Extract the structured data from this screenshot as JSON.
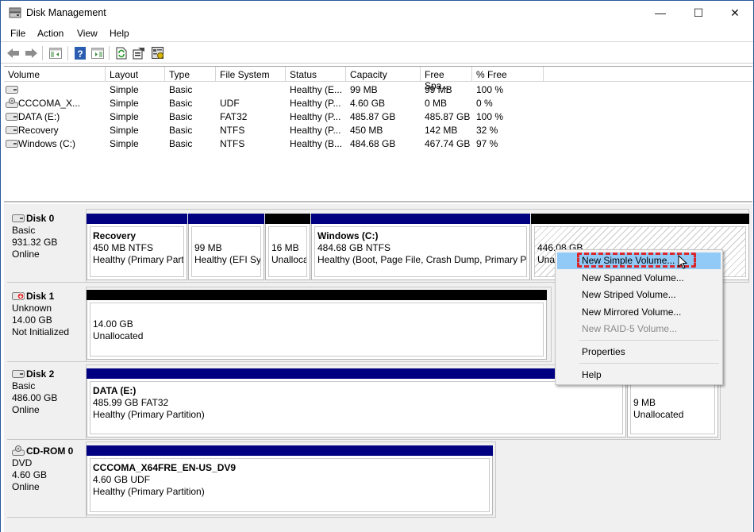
{
  "window": {
    "title": "Disk Management",
    "controls": {
      "minimize": "—",
      "maximize": "☐",
      "close": "✕"
    }
  },
  "menubar": [
    "File",
    "Action",
    "View",
    "Help"
  ],
  "toolbar": {
    "icons": [
      "back-arrow-icon",
      "forward-arrow-icon",
      "show-hide-console-tree-icon",
      "help-icon",
      "show-action-pane-icon",
      "refresh-icon",
      "properties-icon",
      "disk-settings-icon"
    ]
  },
  "volume_list": {
    "columns": [
      "Volume",
      "Layout",
      "Type",
      "File System",
      "Status",
      "Capacity",
      "Free Spa...",
      "% Free"
    ],
    "rows": [
      {
        "icon": "drive-icon",
        "volume": "",
        "layout": "Simple",
        "type": "Basic",
        "fs": "",
        "status": "Healthy (E...",
        "capacity": "99 MB",
        "free": "99 MB",
        "pct": "100 %"
      },
      {
        "icon": "cd-drive-icon",
        "volume": "CCCOMA_X...",
        "layout": "Simple",
        "type": "Basic",
        "fs": "UDF",
        "status": "Healthy (P...",
        "capacity": "4.60 GB",
        "free": "0 MB",
        "pct": "0 %"
      },
      {
        "icon": "drive-icon",
        "volume": "DATA (E:)",
        "layout": "Simple",
        "type": "Basic",
        "fs": "FAT32",
        "status": "Healthy (P...",
        "capacity": "485.87 GB",
        "free": "485.87 GB",
        "pct": "100 %"
      },
      {
        "icon": "drive-icon",
        "volume": "Recovery",
        "layout": "Simple",
        "type": "Basic",
        "fs": "NTFS",
        "status": "Healthy (P...",
        "capacity": "450 MB",
        "free": "142 MB",
        "pct": "32 %"
      },
      {
        "icon": "drive-icon",
        "volume": "Windows (C:)",
        "layout": "Simple",
        "type": "Basic",
        "fs": "NTFS",
        "status": "Healthy (B...",
        "capacity": "484.68 GB",
        "free": "467.74 GB",
        "pct": "97 %"
      }
    ]
  },
  "disks": [
    {
      "name": "Disk 0",
      "kind": "Basic",
      "size": "931.32 GB",
      "state": "Online",
      "partitions": [
        {
          "title": "Recovery",
          "line1": "450 MB NTFS",
          "line2": "Healthy (Primary Part"
        },
        {
          "title": "",
          "line1": "99 MB",
          "line2": "Healthy (EFI Sys"
        },
        {
          "title": "",
          "line1": "16 MB",
          "line2": "Unalloca"
        },
        {
          "title": "Windows  (C:)",
          "line1": "484.68 GB NTFS",
          "line2": "Healthy (Boot, Page File, Crash Dump, Primary Par"
        },
        {
          "title": "",
          "line1": "446.08 GB",
          "line2": "Una"
        }
      ]
    },
    {
      "name": "Disk 1",
      "kind": "Unknown",
      "size": "14.00 GB",
      "state": "Not Initialized",
      "partitions": [
        {
          "title": "",
          "line1": "14.00 GB",
          "line2": "Unallocated"
        }
      ]
    },
    {
      "name": "Disk 2",
      "kind": "Basic",
      "size": "486.00 GB",
      "state": "Online",
      "partitions": [
        {
          "title": "DATA  (E:)",
          "line1": "485.99 GB FAT32",
          "line2": "Healthy (Primary Partition)"
        },
        {
          "title": "",
          "line1": "9 MB",
          "line2": "Unallocated"
        }
      ]
    },
    {
      "name": "CD-ROM 0",
      "kind": "DVD",
      "size": "4.60 GB",
      "state": "Online",
      "partitions": [
        {
          "title": "CCCOMA_X64FRE_EN-US_DV9",
          "line1": "4.60 GB UDF",
          "line2": "Healthy (Primary Partition)"
        }
      ]
    }
  ],
  "context_menu": {
    "items": [
      {
        "label": "New Simple Volume...",
        "state": "selected"
      },
      {
        "label": "New Spanned Volume...",
        "state": "enabled"
      },
      {
        "label": "New Striped Volume...",
        "state": "enabled"
      },
      {
        "label": "New Mirrored Volume...",
        "state": "enabled"
      },
      {
        "label": "New RAID-5 Volume...",
        "state": "disabled"
      },
      {
        "label": "Properties",
        "state": "enabled"
      },
      {
        "label": "Help",
        "state": "enabled"
      }
    ]
  },
  "colors": {
    "primary_partition_bar": "#000080",
    "unallocated_bar": "#000000",
    "menu_highlight": "#91c9f7",
    "annotation_box": "#d9262c"
  }
}
